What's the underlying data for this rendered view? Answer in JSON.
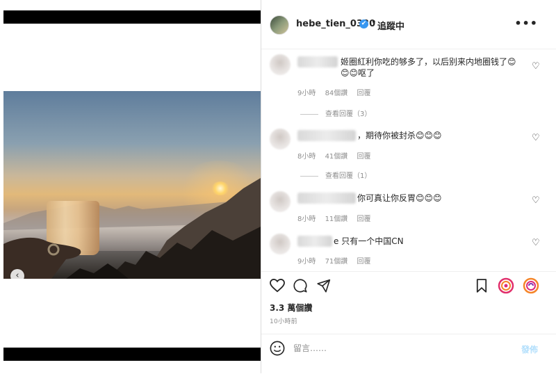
{
  "header": {
    "username": "hebe_tien_0330",
    "verified_mark": "✔",
    "separator": "•",
    "follow_label": "追蹤中",
    "more_label": "•••"
  },
  "carousel": {
    "prev_label": "‹"
  },
  "comments": [
    {
      "text": "姬圈紅利你吃的够多了，以后别来内地圈钱了😊😊😊呕了",
      "time": "9小時",
      "likes": "84個讚",
      "reply": "回覆",
      "view_replies": "查看回覆（3）"
    },
    {
      "text": "，期待你被封杀😊😊😊",
      "time": "8小時",
      "likes": "41個讚",
      "reply": "回覆",
      "view_replies": "查看回覆（1）"
    },
    {
      "text": "你可真让你反胃😊😊😊",
      "time": "8小時",
      "likes": "11個讚",
      "reply": "回覆"
    },
    {
      "text": "e 只有一个中国CN",
      "time": "9小時",
      "likes": "71個讚",
      "reply": "回覆"
    }
  ],
  "post": {
    "likes": "3.3 萬個讚",
    "time": "10小時前"
  },
  "composer": {
    "placeholder": "留言……",
    "post_label": "發佈"
  },
  "icons": [
    "heart-icon",
    "comment-icon",
    "share-icon",
    "save-icon",
    "story-ring-icon",
    "emoji-icon"
  ],
  "colors": {
    "verified": "#3897f0",
    "meta": "#8e8e8e",
    "post_disabled": "#b2dffc"
  }
}
